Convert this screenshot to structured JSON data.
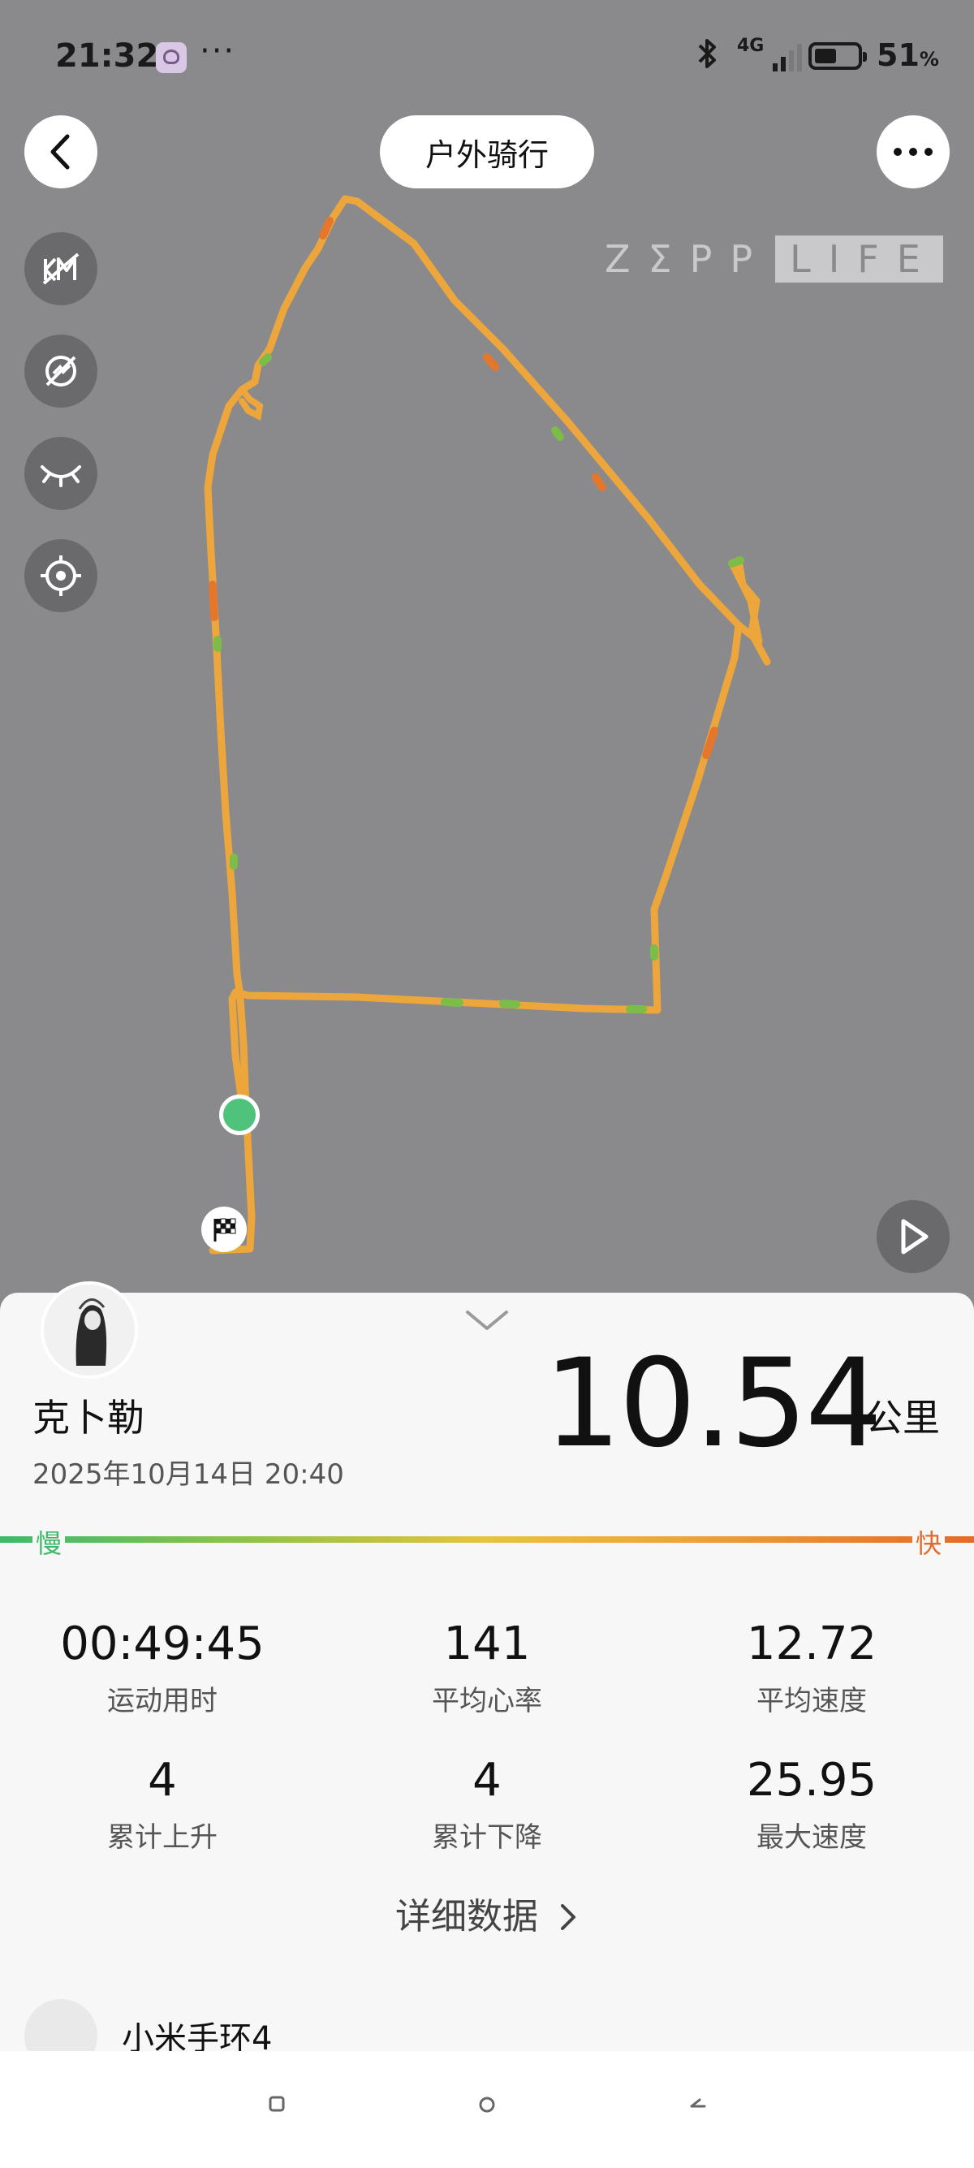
{
  "status_bar": {
    "time": "21:32",
    "dots": "···",
    "network": "4G",
    "battery_percent": "51",
    "battery_unit": "%",
    "battery_level": 0.51
  },
  "header": {
    "title": "户外骑行"
  },
  "map": {
    "brand_left": "ZΣPP",
    "brand_right": "LIFE",
    "route_color": "#eda63c",
    "start_color": "#4fc27b"
  },
  "workout": {
    "user_name": "克卜勒",
    "date": "2025年10月14日 20:40",
    "distance": "10.54",
    "distance_unit": "公里",
    "speed_scale": {
      "slow": "慢",
      "fast": "快"
    },
    "stats": [
      {
        "value": "00:49:45",
        "label": "运动用时"
      },
      {
        "value": "141",
        "label": "平均心率"
      },
      {
        "value": "12.72",
        "label": "平均速度"
      },
      {
        "value": "4",
        "label": "累计上升"
      },
      {
        "value": "4",
        "label": "累计下降"
      },
      {
        "value": "25.95",
        "label": "最大速度"
      }
    ],
    "detail_link": "详细数据"
  },
  "device": {
    "name": "小米手环4"
  }
}
